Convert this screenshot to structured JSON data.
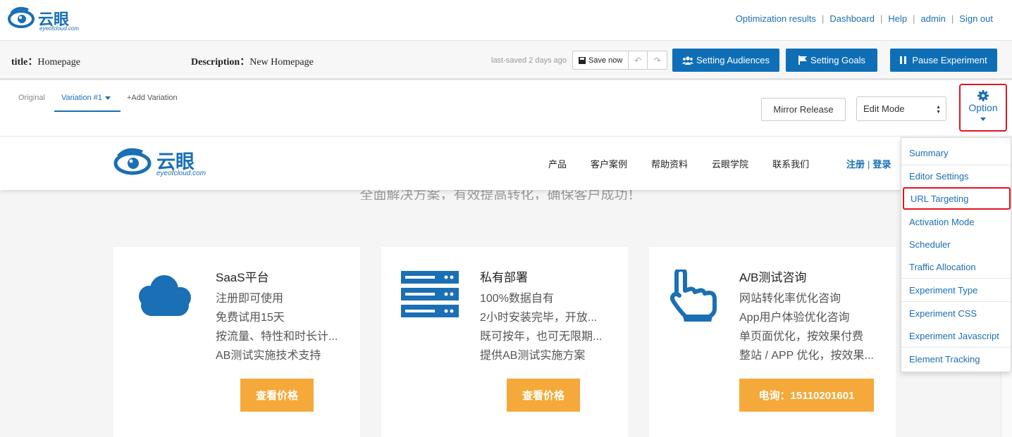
{
  "brand": {
    "name": "云眼",
    "domain": "eyeofcloud.com"
  },
  "top_links": [
    "Optimization results",
    "Dashboard",
    "Help",
    "admin",
    "Sign out"
  ],
  "experiment": {
    "title_label": "title：",
    "title_value": "Homepage",
    "desc_label": "Description：",
    "desc_value": "New Homepage",
    "last_saved": "last-saved 2 days ago",
    "save_label": "Save now"
  },
  "actions": {
    "audiences": "Setting Audiences",
    "goals": "Setting Goals",
    "pause": "Pause Experiment"
  },
  "variation_tabs": {
    "original": "Original",
    "variation": "Variation #1",
    "add": "+Add Variation"
  },
  "mirror_release": "Mirror Release",
  "mode_select": {
    "selected": "Edit Mode"
  },
  "option_label": "Option",
  "option_menu": [
    "Summary",
    "Editor Settings",
    "URL Targeting",
    "Activation Mode",
    "Scheduler",
    "Traffic Allocation",
    "Experiment Type",
    "Experiment CSS",
    "Experiment Javascript",
    "Element Tracking"
  ],
  "site": {
    "nav": [
      "产品",
      "客户案例",
      "帮助资料",
      "云眼学院",
      "联系我们"
    ],
    "register": "注册",
    "login": "登录",
    "slogan": "全面解决方案，有效提高转化，确保客户成功！",
    "cards": [
      {
        "title": "SaaS平台",
        "lines": [
          "注册即可使用",
          "免费试用15天",
          "按流量、特性和时长计...",
          "AB测试实施技术支持"
        ],
        "cta": "查看价格",
        "icon": "cloud-icon"
      },
      {
        "title": "私有部署",
        "lines": [
          "100%数据自有",
          "2小时安装完毕，开放...",
          "既可按年，也可无限期...",
          "提供AB测试实施方案"
        ],
        "cta": "查看价格",
        "icon": "server-icon"
      },
      {
        "title": "A/B测试咨询",
        "lines": [
          "网站转化率优化咨询",
          "App用户体验优化咨询",
          "单页面优化，按效果付费",
          "整站 / APP 优化，按效果..."
        ],
        "cta": "电询：15110201601",
        "icon": "pointing-hand-icon"
      }
    ]
  },
  "colors": {
    "brand_blue": "#0f6fb6",
    "link_blue": "#1a6fb5",
    "cta_orange": "#f5a93a",
    "highlight_red": "#e0141e"
  }
}
